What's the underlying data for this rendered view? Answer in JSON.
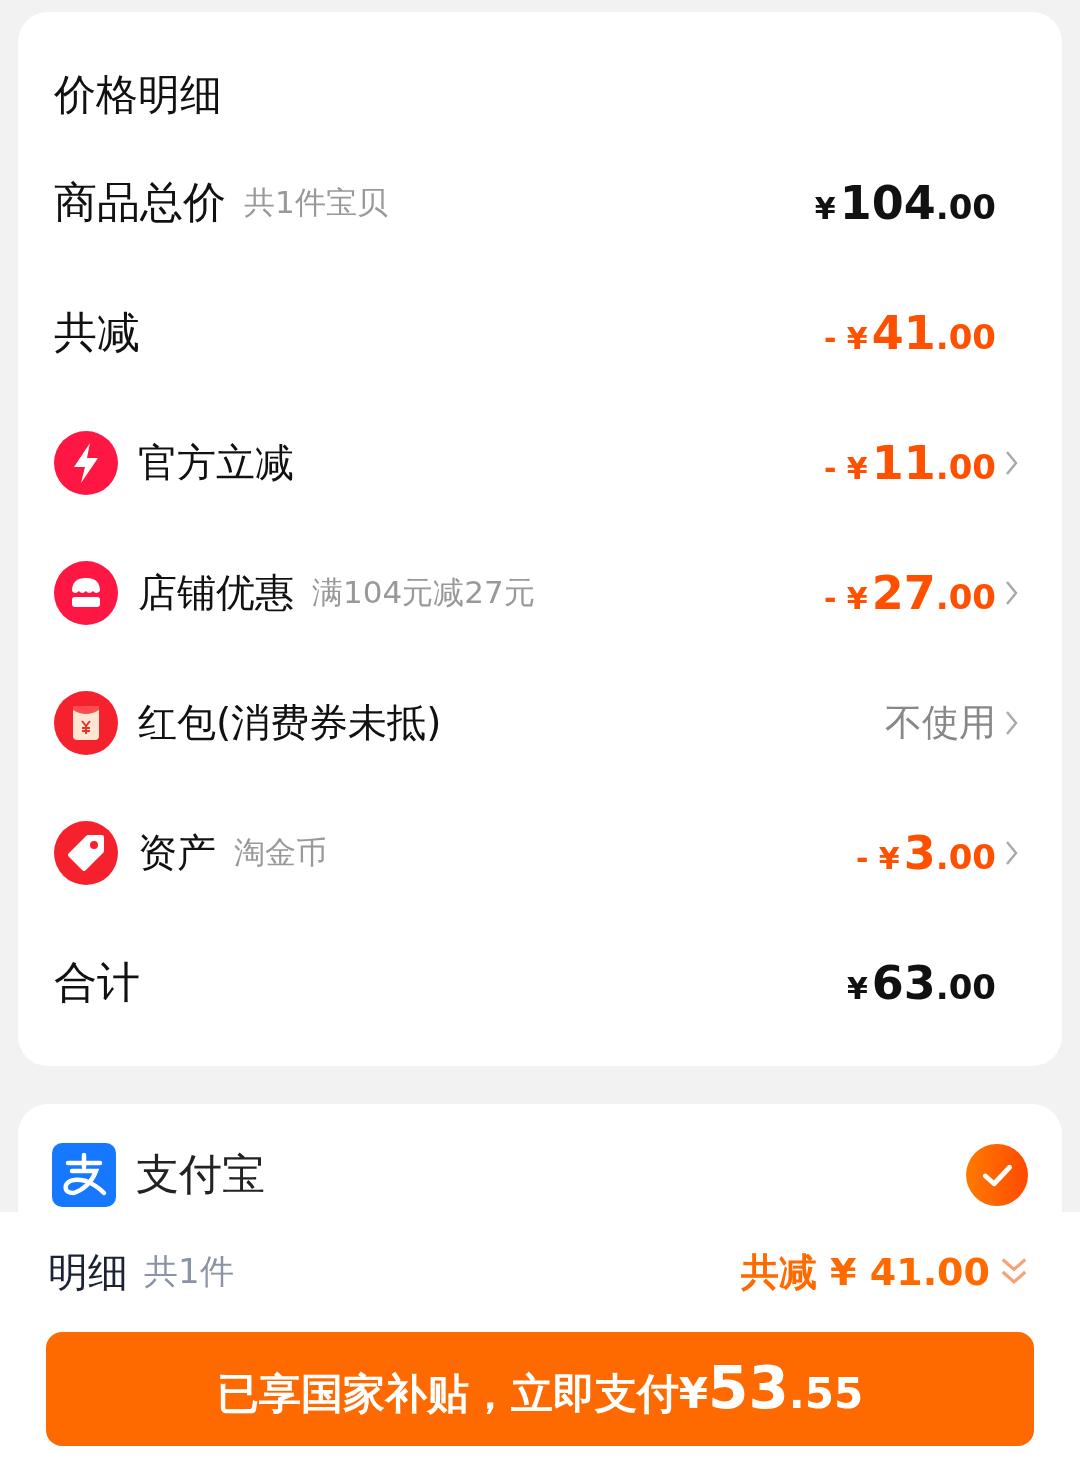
{
  "price_detail": {
    "title": "价格明细",
    "rows": [
      {
        "kind": "subtotal",
        "label": "商品总价",
        "note": "共1件宝贝",
        "amount": "¥104.00",
        "chevron": false
      },
      {
        "kind": "discount_total",
        "label": "共减",
        "amount": "- ¥41.00",
        "chevron": false
      },
      {
        "kind": "official",
        "label": "官方立减",
        "amount": "- ¥11.00",
        "chevron": true
      },
      {
        "kind": "shop",
        "label": "店铺优惠",
        "note": "满104元减27元",
        "amount": "- ¥27.00",
        "chevron": true
      },
      {
        "kind": "packet",
        "label": "红包(消费券未抵)",
        "value": "不使用",
        "chevron": true
      },
      {
        "kind": "assets",
        "label": "资产",
        "note": "淘金币",
        "amount": "- ¥3.00",
        "chevron": true
      },
      {
        "kind": "total",
        "label": "合计",
        "amount": "¥63.00",
        "chevron": false
      }
    ]
  },
  "payment": {
    "methods": [
      {
        "name": "支付宝",
        "selected": true
      }
    ]
  },
  "footer": {
    "label": "明细",
    "count": "共1件",
    "discount": "共减 ¥ 41.00",
    "button": "已享国家补贴，立即支付¥53.55"
  }
}
